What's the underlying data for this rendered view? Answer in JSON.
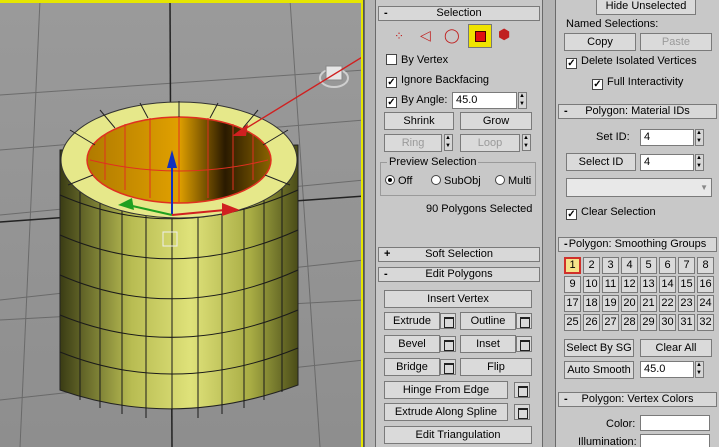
{
  "selection": {
    "title": "Selection",
    "by_vertex": "By Vertex",
    "ignore_backfacing": "Ignore Backfacing",
    "by_angle": "By Angle:",
    "angle_value": "45.0",
    "shrink": "Shrink",
    "grow": "Grow",
    "ring": "Ring",
    "loop": "Loop",
    "preview_title": "Preview Selection",
    "preview_off": "Off",
    "preview_subobj": "SubObj",
    "preview_multi": "Multi",
    "status": "90 Polygons Selected"
  },
  "soft_selection": {
    "title": "Soft Selection",
    "sign": "+"
  },
  "edit_polygons": {
    "title": "Edit Polygons",
    "sign": "-",
    "insert_vertex": "Insert Vertex",
    "extrude": "Extrude",
    "outline": "Outline",
    "bevel": "Bevel",
    "inset": "Inset",
    "bridge": "Bridge",
    "flip": "Flip",
    "hinge_from_edge": "Hinge From Edge",
    "extrude_along_spline": "Extrude Along Spline",
    "edit_triangulation": "Edit Triangulation"
  },
  "right": {
    "hide_unselected": "Hide Unselected",
    "named_selections": "Named Selections:",
    "copy": "Copy",
    "paste": "Paste",
    "delete_isolated": "Delete Isolated Vertices",
    "full_interactivity": "Full Interactivity"
  },
  "material_ids": {
    "title": "Polygon: Material IDs",
    "set_id": "Set ID:",
    "set_id_value": "4",
    "select_id": "Select ID",
    "select_id_value": "4",
    "clear_selection": "Clear Selection"
  },
  "smoothing": {
    "title": "Polygon: Smoothing Groups",
    "groups": [
      "1",
      "2",
      "3",
      "4",
      "5",
      "6",
      "7",
      "8",
      "9",
      "10",
      "11",
      "12",
      "13",
      "14",
      "15",
      "16",
      "17",
      "18",
      "19",
      "20",
      "21",
      "22",
      "23",
      "24",
      "25",
      "26",
      "27",
      "28",
      "29",
      "30",
      "31",
      "32"
    ],
    "active_group": "1",
    "select_by_sg": "Select By SG",
    "clear_all": "Clear All",
    "auto_smooth": "Auto Smooth",
    "auto_smooth_value": "45.0"
  },
  "vertex_colors": {
    "title": "Polygon: Vertex Colors",
    "color": "Color:",
    "illumination": "Illumination:"
  },
  "colors": {
    "viewport_bg": "#949494",
    "mesh_face": "#d8dc70",
    "selection_red": "#e03020",
    "highlight_yellow": "#f0e400"
  }
}
